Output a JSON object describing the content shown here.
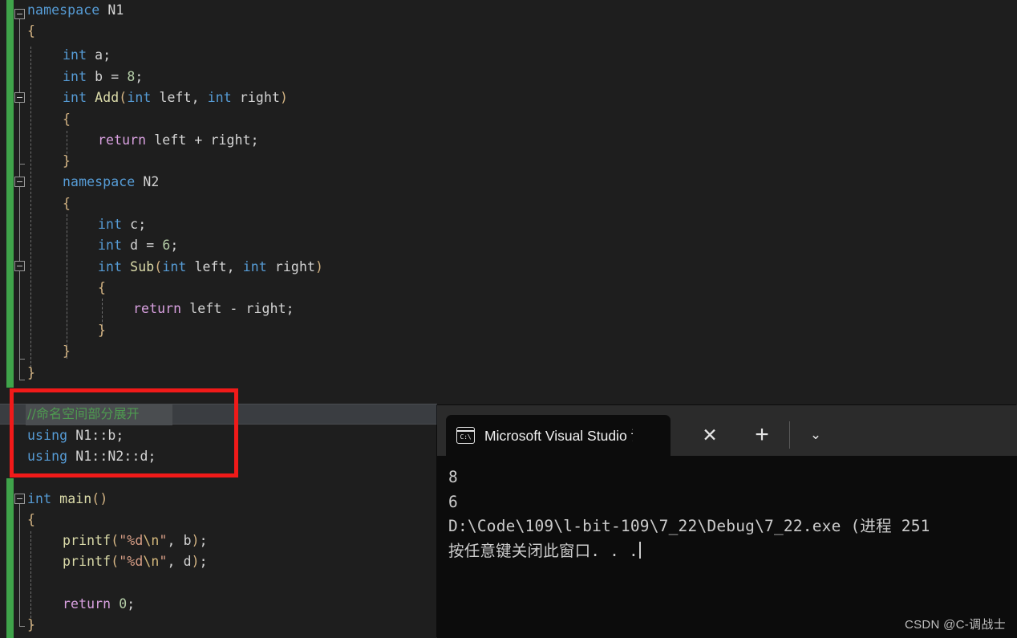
{
  "editor": {
    "background": "#1E1E1E",
    "change_bar_color": "#3FA34A",
    "lines": [
      {
        "indent": 0,
        "text": "namespace N1"
      },
      {
        "indent": 1,
        "text": "{"
      },
      {
        "indent": 2,
        "text": "int a;"
      },
      {
        "indent": 2,
        "text": "int b = 8;"
      },
      {
        "indent": 2,
        "text": "int Add(int left, int right)"
      },
      {
        "indent": 2,
        "text": "{"
      },
      {
        "indent": 3,
        "text": "return left + right;"
      },
      {
        "indent": 2,
        "text": "}"
      },
      {
        "indent": 2,
        "text": "namespace N2"
      },
      {
        "indent": 2,
        "text": "{"
      },
      {
        "indent": 3,
        "text": "int c;"
      },
      {
        "indent": 3,
        "text": "int d = 6;"
      },
      {
        "indent": 3,
        "text": "int Sub(int left, int right)"
      },
      {
        "indent": 3,
        "text": "{"
      },
      {
        "indent": 4,
        "text": "return left - right;"
      },
      {
        "indent": 3,
        "text": "}"
      },
      {
        "indent": 2,
        "text": "}"
      },
      {
        "indent": 1,
        "text": "}"
      },
      {
        "indent": 0,
        "text": "//命名空间部分展开"
      },
      {
        "indent": 0,
        "text": "using N1::b;"
      },
      {
        "indent": 0,
        "text": "using N1::N2::d;"
      },
      {
        "indent": 0,
        "text": "int main()"
      },
      {
        "indent": 1,
        "text": "{"
      },
      {
        "indent": 2,
        "text": "printf(\"%d\\n\", b);"
      },
      {
        "indent": 2,
        "text": "printf(\"%d\\n\", d);"
      },
      {
        "indent": 2,
        "text": ""
      },
      {
        "indent": 2,
        "text": "return 0;"
      },
      {
        "indent": 1,
        "text": "}"
      }
    ],
    "comment_line": "//命名空间部分展开",
    "using_line_1": "using N1::b;",
    "using_line_2": "using N1::N2::d;"
  },
  "annotation": {
    "box_color": "#F01A19",
    "label": "red-highlight-box"
  },
  "terminal": {
    "tab": {
      "icon": "console-icon",
      "icon_text": "C:\\",
      "title": "Microsoft Visual Studio 调试控"
    },
    "controls": {
      "close": "✕",
      "new_tab": "+",
      "dropdown": "⌄"
    },
    "output": [
      "8",
      "6",
      "",
      "D:\\Code\\109\\l-bit-109\\7_22\\Debug\\7_22.exe (进程 251",
      "按任意键关闭此窗口. . ."
    ],
    "background": "#0C0C0C",
    "tabbar_background": "#2B2B2B"
  },
  "watermark": {
    "text": "CSDN @C-调战士"
  }
}
